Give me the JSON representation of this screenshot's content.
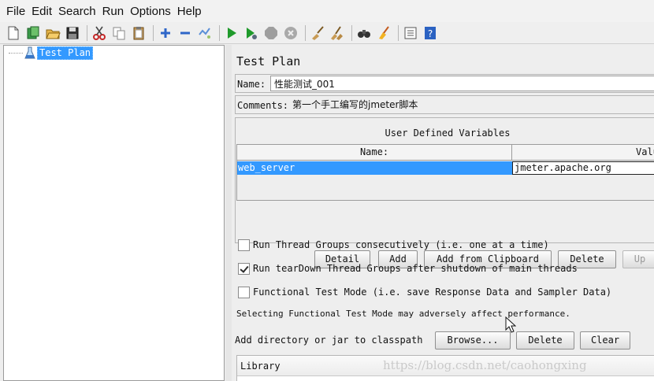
{
  "menu": [
    "File",
    "Edit",
    "Search",
    "Run",
    "Options",
    "Help"
  ],
  "toolbar": {
    "icons": [
      "new-icon",
      "templates-icon",
      "open-icon",
      "save-icon",
      "cut-icon",
      "copy-icon",
      "paste-icon",
      "expand-icon",
      "collapse-icon",
      "toggle-icon",
      "start-icon",
      "start-no-pause-icon",
      "stop-icon",
      "shutdown-icon",
      "clear-icon",
      "clear-all-icon",
      "search-icon",
      "reset-search-icon",
      "function-helper-icon",
      "help-icon"
    ]
  },
  "tree": {
    "root_label": "Test Plan"
  },
  "panel": {
    "title": "Test Plan",
    "name_label": "Name:",
    "name_value": "性能测试_001",
    "comments_label": "Comments:",
    "comments_value": "第一个手工编写的jmeter脚本",
    "udv_title": "User Defined Variables",
    "columns": [
      "Name:",
      "Valu"
    ],
    "rows": [
      {
        "name": "web_server",
        "value": "jmeter.apache.org"
      }
    ],
    "buttons": {
      "detail": "Detail",
      "add": "Add",
      "add_clipboard": "Add from Clipboard",
      "delete": "Delete",
      "up": "Up"
    },
    "options": [
      {
        "label": "Run Thread Groups consecutively (i.e. one at a time)",
        "checked": false
      },
      {
        "label": "Run tearDown Thread Groups after shutdown of main threads",
        "checked": true
      },
      {
        "label": "Functional Test Mode (i.e. save Response Data and Sampler Data)",
        "checked": false
      }
    ],
    "note": "Selecting Functional Test Mode may adversely affect performance.",
    "classpath_label": "Add directory or jar to classpath",
    "classpath_buttons": {
      "browse": "Browse...",
      "delete": "Delete",
      "clear": "Clear"
    },
    "library_header": "Library"
  },
  "watermark": "https://blog.csdn.net/caohongxing"
}
